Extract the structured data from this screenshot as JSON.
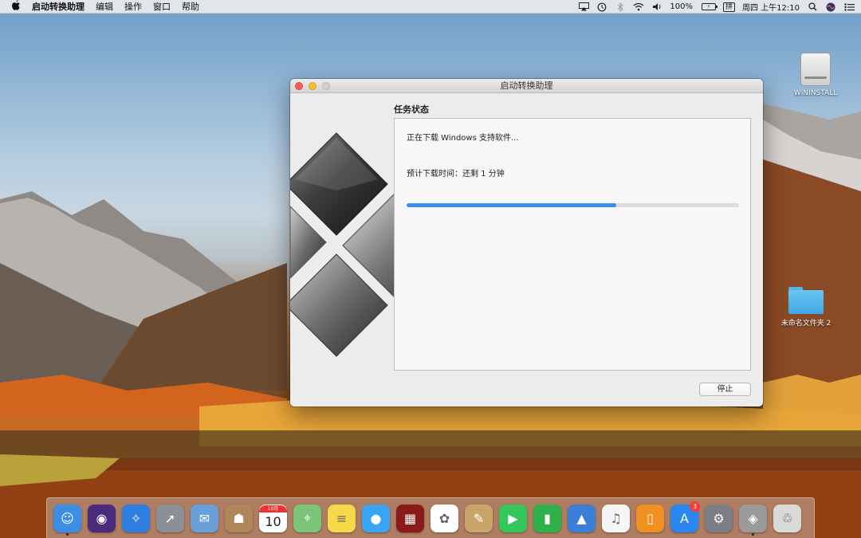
{
  "menubar": {
    "app_name": "启动转换助理",
    "menus": [
      "编辑",
      "操作",
      "窗口",
      "帮助"
    ],
    "battery": "100%",
    "battery_badge": "⚡",
    "input_method": "拼",
    "clock": "周四 上午12:10"
  },
  "window": {
    "title": "启动转换助理",
    "section_title": "任务状态",
    "status_text": "正在下载 Windows 支持软件...",
    "eta_text": "预计下载时间：还剩 1 分钟",
    "progress_fraction": 0.63,
    "progress_color": "#3b8bea",
    "stop_label": "停止"
  },
  "desktop": {
    "drive_label": "WININSTALL",
    "folder_label": "未命名文件夹 2"
  },
  "dock": {
    "calendar_month": "10月",
    "calendar_day": "10",
    "app_store_badge": "3",
    "apps": [
      {
        "name": "finder-icon",
        "color": "#3a8ee6",
        "glyph": "☺",
        "running": true
      },
      {
        "name": "siri-icon",
        "color": "#4a2a7a",
        "glyph": "◉",
        "running": false
      },
      {
        "name": "safari-icon",
        "color": "#2f7fe0",
        "glyph": "✧",
        "running": false
      },
      {
        "name": "launchpad-icon",
        "color": "#8b8f96",
        "glyph": "➚",
        "running": false
      },
      {
        "name": "mail-icon",
        "color": "#6aa0d8",
        "glyph": "✉",
        "running": false
      },
      {
        "name": "contacts-icon",
        "color": "#b0875a",
        "glyph": "☗",
        "running": false
      },
      {
        "name": "calendar-icon",
        "color": "#ffffff",
        "glyph": "",
        "running": false
      },
      {
        "name": "maps-icon",
        "color": "#7cc47a",
        "glyph": "⌖",
        "running": false
      },
      {
        "name": "notes-icon",
        "color": "#f6d84a",
        "glyph": "≡",
        "running": false
      },
      {
        "name": "messages-icon",
        "color": "#3aa5f5",
        "glyph": "●",
        "running": false
      },
      {
        "name": "photo-booth-icon",
        "color": "#8a1b1b",
        "glyph": "▦",
        "running": false
      },
      {
        "name": "photos-icon",
        "color": "#ffffff",
        "glyph": "✿",
        "running": false
      },
      {
        "name": "notes-pencil-icon",
        "color": "#c9a56a",
        "glyph": "✎",
        "running": false
      },
      {
        "name": "facetime-icon",
        "color": "#34c759",
        "glyph": "▶",
        "running": false
      },
      {
        "name": "numbers-icon",
        "color": "#2fb14a",
        "glyph": "▮",
        "running": false
      },
      {
        "name": "keynote-icon",
        "color": "#3b7fd6",
        "glyph": "▲",
        "running": false
      },
      {
        "name": "itunes-icon",
        "color": "#f5f5f5",
        "glyph": "♫",
        "running": false
      },
      {
        "name": "ibooks-icon",
        "color": "#f09020",
        "glyph": "▯",
        "running": false
      },
      {
        "name": "app-store-icon",
        "color": "#2a86f0",
        "glyph": "A",
        "running": false
      },
      {
        "name": "system-preferences-icon",
        "color": "#7d7d85",
        "glyph": "⚙",
        "running": false
      },
      {
        "name": "boot-camp-icon",
        "color": "#9a9a9a",
        "glyph": "◈",
        "running": true
      },
      {
        "name": "trash-icon",
        "color": "#d9d9d9",
        "glyph": "♲",
        "running": false
      }
    ]
  }
}
